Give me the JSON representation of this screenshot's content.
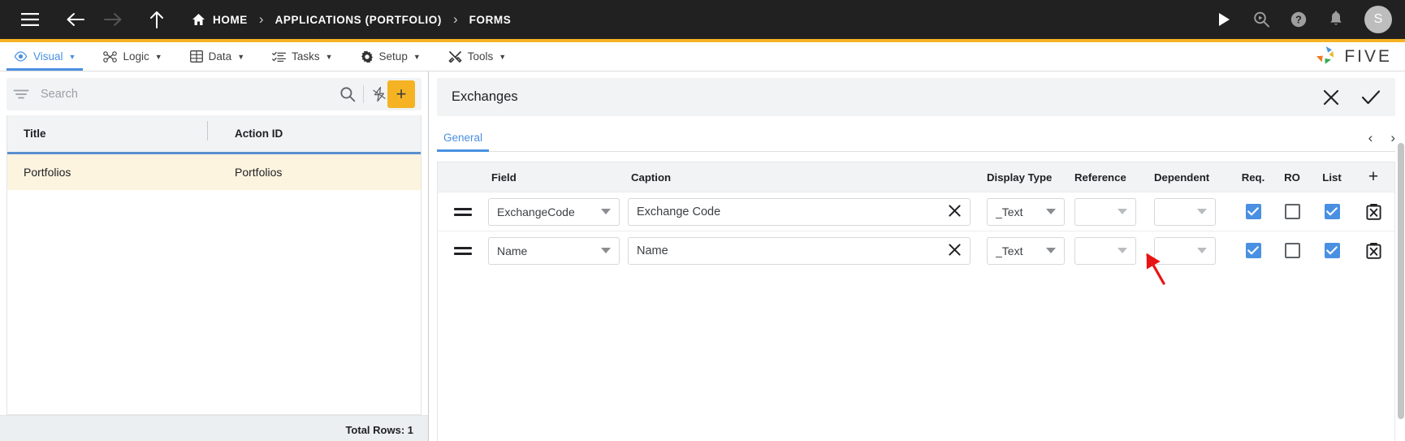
{
  "topbar": {
    "menu_icon": "hamburger-icon",
    "back_icon": "arrow-left-icon",
    "forward_icon": "arrow-right-icon",
    "up_icon": "arrow-up-icon",
    "breadcrumbs": [
      {
        "label": "HOME",
        "icon": "home-icon"
      },
      {
        "label": "APPLICATIONS (PORTFOLIO)",
        "icon": ""
      },
      {
        "label": "FORMS",
        "icon": ""
      }
    ],
    "separator": "›",
    "actions": [
      {
        "name": "run-icon"
      },
      {
        "name": "search-icon"
      },
      {
        "name": "help-icon"
      },
      {
        "name": "notifications-icon"
      }
    ],
    "avatar_initial": "S",
    "bg_color": "#212121",
    "accent_color": "#f5b324"
  },
  "menubar": {
    "tabs": [
      {
        "label": "Visual",
        "icon": "eye-icon",
        "active": true
      },
      {
        "label": "Logic",
        "icon": "flow-icon",
        "active": false
      },
      {
        "label": "Data",
        "icon": "table-icon",
        "active": false
      },
      {
        "label": "Tasks",
        "icon": "tasks-icon",
        "active": false
      },
      {
        "label": "Setup",
        "icon": "gear-icon",
        "active": false
      },
      {
        "label": "Tools",
        "icon": "tools-icon",
        "active": false
      }
    ],
    "caret": "▼",
    "logo_text": "FIVE",
    "active_color": "#4a90e2"
  },
  "left_panel": {
    "search": {
      "placeholder": "Search",
      "value": ""
    },
    "filter_icon": "filter-icon",
    "search_icon": "search-icon",
    "lightning_icon": "lightning-icon",
    "add_label": "+",
    "columns": [
      "Title",
      "Action ID"
    ],
    "rows": [
      {
        "title": "Portfolios",
        "action_id": "Portfolios"
      }
    ],
    "footer": "Total Rows: 1",
    "row_highlight_color": "#fdf4e0",
    "header_underline_color": "#5b8fd1"
  },
  "right_panel": {
    "title": "Exchanges",
    "close_icon": "close-icon",
    "confirm_icon": "check-icon",
    "tabs": [
      {
        "label": "General",
        "active": true
      }
    ],
    "prev_icon": "‹",
    "next_icon": "›",
    "grid": {
      "columns": [
        "",
        "Field",
        "Caption",
        "Display Type",
        "Reference",
        "Dependent",
        "Req.",
        "RO",
        "List",
        "+"
      ],
      "add_row_label": "+",
      "rows": [
        {
          "drag": "drag-handle-icon",
          "field": "ExchangeCode",
          "caption": "Exchange Code",
          "display_type": "_Text",
          "reference": "",
          "dependent": "",
          "req": true,
          "ro": false,
          "list": true,
          "delete_icon": "delete-icon"
        },
        {
          "drag": "drag-handle-icon",
          "field": "Name",
          "caption": "Name",
          "display_type": "_Text",
          "reference": "",
          "dependent": "",
          "req": true,
          "ro": false,
          "list": true,
          "delete_icon": "delete-icon"
        }
      ],
      "checkbox_on_color": "#4a90e2"
    },
    "annotation": {
      "type": "arrow",
      "color": "#e81313",
      "points_to": "row-2-list-checkbox"
    }
  }
}
